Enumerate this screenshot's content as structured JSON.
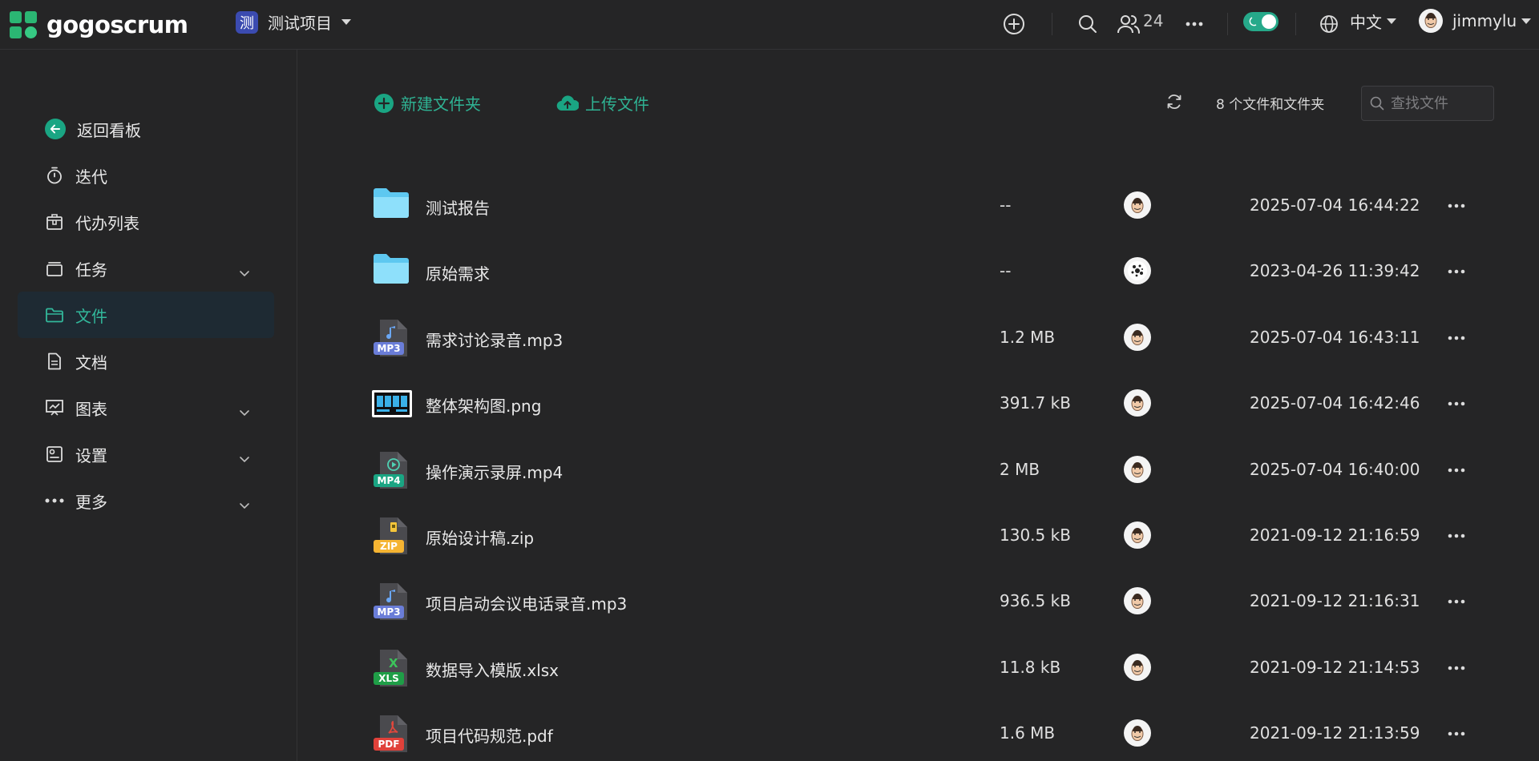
{
  "app": {
    "logo_text": "gogoscrum"
  },
  "project": {
    "badge": "测",
    "name": "测试项目"
  },
  "topbar": {
    "member_count": "24",
    "language": "中文",
    "user_name": "jimmylu"
  },
  "sidebar": {
    "back_label": "返回看板",
    "items": [
      {
        "label": "迭代",
        "icon": "stopwatch-icon"
      },
      {
        "label": "代办列表",
        "icon": "box-icon"
      },
      {
        "label": "任务",
        "icon": "cards-icon",
        "expandable": true
      },
      {
        "label": "文件",
        "icon": "folder-icon",
        "active": true
      },
      {
        "label": "文档",
        "icon": "document-icon"
      },
      {
        "label": "图表",
        "icon": "chart-icon",
        "expandable": true
      },
      {
        "label": "设置",
        "icon": "settings-icon",
        "expandable": true
      },
      {
        "label": "更多",
        "icon": "more-icon",
        "expandable": true
      }
    ]
  },
  "toolbar": {
    "new_folder_label": "新建文件夹",
    "upload_label": "上传文件",
    "count_label": "8 个文件和文件夹",
    "search_placeholder": "查找文件"
  },
  "colors": {
    "accent": "#2fb293",
    "background": "#252526",
    "active_bg": "#1e2a33"
  },
  "files": [
    {
      "name": "测试报告",
      "size": "--",
      "date": "2025-07-04 16:44:22",
      "type": "folder"
    },
    {
      "name": "原始需求",
      "size": "--",
      "date": "2023-04-26 11:39:42",
      "type": "folder"
    },
    {
      "name": "需求讨论录音.mp3",
      "size": "1.2 MB",
      "date": "2025-07-04 16:43:11",
      "type": "mp3",
      "badge": "MP3"
    },
    {
      "name": "整体架构图.png",
      "size": "391.7 kB",
      "date": "2025-07-04 16:42:46",
      "type": "png"
    },
    {
      "name": "操作演示录屏.mp4",
      "size": "2 MB",
      "date": "2025-07-04 16:40:00",
      "type": "mp4",
      "badge": "MP4"
    },
    {
      "name": "原始设计稿.zip",
      "size": "130.5 kB",
      "date": "2021-09-12 21:16:59",
      "type": "zip",
      "badge": "ZIP"
    },
    {
      "name": "项目启动会议电话录音.mp3",
      "size": "936.5 kB",
      "date": "2021-09-12 21:16:31",
      "type": "mp3",
      "badge": "MP3"
    },
    {
      "name": "数据导入模版.xlsx",
      "size": "11.8 kB",
      "date": "2021-09-12 21:14:53",
      "type": "xls",
      "badge": "XLS"
    },
    {
      "name": "项目代码规范.pdf",
      "size": "1.6 MB",
      "date": "2021-09-12 21:13:59",
      "type": "pdf",
      "badge": "PDF"
    }
  ]
}
